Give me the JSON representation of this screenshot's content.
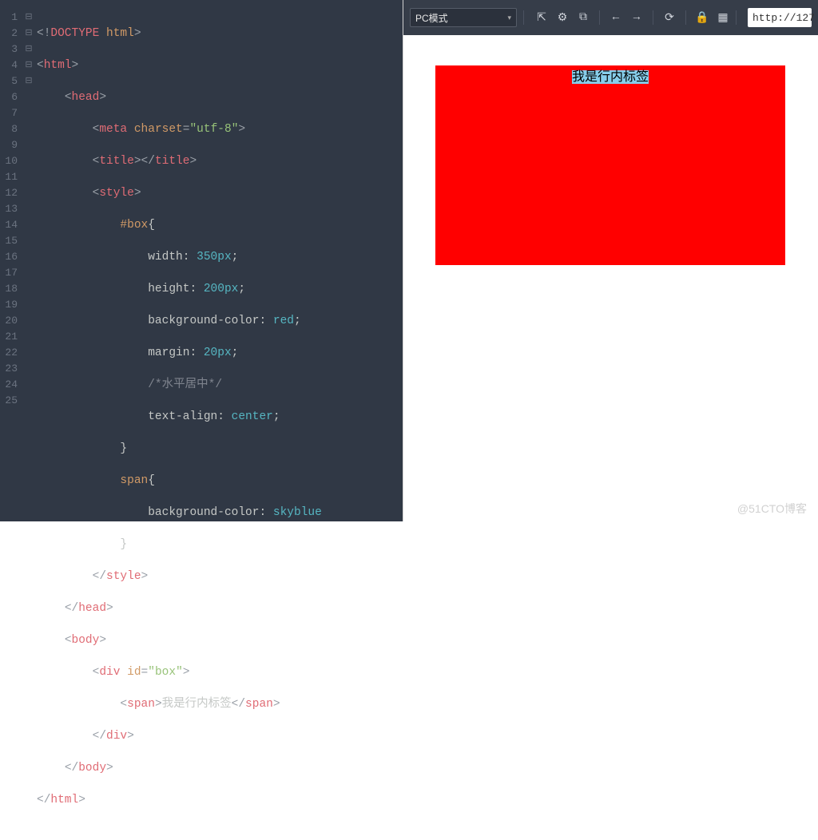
{
  "editor": {
    "line_numbers": [
      "1",
      "2",
      "3",
      "4",
      "5",
      "6",
      "7",
      "8",
      "9",
      "10",
      "11",
      "12",
      "13",
      "14",
      "15",
      "16",
      "17",
      "18",
      "19",
      "20",
      "21",
      "22",
      "23",
      "24",
      "25"
    ],
    "fold_markers": [
      "",
      "⊟",
      "⊟",
      "",
      "",
      "⊟",
      "",
      "",
      "",
      "",
      "",
      "",
      "",
      "",
      "",
      "",
      "",
      "",
      "",
      "⊟",
      "⊟",
      "",
      "",
      "",
      ""
    ]
  },
  "code": {
    "l1": {
      "a": "<!",
      "b": "DOCTYPE",
      "c": " ",
      "d": "html",
      "e": ">"
    },
    "l2": {
      "a": "<",
      "b": "html",
      "c": ">"
    },
    "l3": {
      "indent": "    ",
      "a": "<",
      "b": "head",
      "c": ">"
    },
    "l4": {
      "indent": "        ",
      "a": "<",
      "b": "meta",
      "c": " ",
      "attr": "charset",
      "eq": "=",
      "q1": "\"",
      "v": "utf-8",
      "q2": "\"",
      "d": ">"
    },
    "l5": {
      "indent": "        ",
      "a": "<",
      "b": "title",
      "c": ">",
      "d": "</",
      "e": "title",
      "f": ">"
    },
    "l6": {
      "indent": "        ",
      "a": "<",
      "b": "style",
      "c": ">"
    },
    "l7": {
      "indent": "            ",
      "sel": "#box",
      "brace": "{"
    },
    "l8": {
      "indent": "                ",
      "prop": "width",
      "colon": ": ",
      "val": "350px",
      "sc": ";"
    },
    "l9": {
      "indent": "                ",
      "prop": "height",
      "colon": ": ",
      "val": "200px",
      "sc": ";"
    },
    "l10": {
      "indent": "                ",
      "prop": "background-color",
      "colon": ": ",
      "val": "red",
      "sc": ";"
    },
    "l11": {
      "indent": "                ",
      "prop": "margin",
      "colon": ": ",
      "val": "20px",
      "sc": ";"
    },
    "l12": {
      "indent": "                ",
      "comment": "/*水平居中*/"
    },
    "l13": {
      "indent": "                ",
      "prop": "text-align",
      "colon": ": ",
      "val": "center",
      "sc": ";"
    },
    "l14": {
      "indent": "            ",
      "brace": "}"
    },
    "l15": {
      "indent": "            ",
      "sel": "span",
      "brace": "{"
    },
    "l16": {
      "indent": "                ",
      "prop": "background-color",
      "colon": ": ",
      "val": "skyblue"
    },
    "l17": {
      "indent": "            ",
      "brace": "}"
    },
    "l18": {
      "indent": "        ",
      "a": "</",
      "b": "style",
      "c": ">"
    },
    "l19": {
      "indent": "    ",
      "a": "</",
      "b": "head",
      "c": ">"
    },
    "l20": {
      "indent": "    ",
      "a": "<",
      "b": "body",
      "c": ">"
    },
    "l21": {
      "indent": "        ",
      "a": "<",
      "b": "div",
      "c": " ",
      "attr": "id",
      "eq": "=",
      "q1": "\"",
      "v": "box",
      "q2": "\"",
      "d": ">"
    },
    "l22": {
      "indent": "            ",
      "a": "<",
      "b": "span",
      "c": ">",
      "text": "我是行内标签",
      "d": "</",
      "e": "span",
      "f": ">"
    },
    "l23": {
      "indent": "        ",
      "a": "</",
      "b": "div",
      "c": ">"
    },
    "l24": {
      "indent": "    ",
      "a": "</",
      "b": "body",
      "c": ">"
    },
    "l25": {
      "a": "</",
      "b": "html",
      "c": ">"
    }
  },
  "browser": {
    "mode_label": "PC模式",
    "url": "http://127",
    "rendered_span_text": "我是行内标签"
  },
  "icons": {
    "popout": "⇱",
    "gear": "⚙",
    "screenshot": "⧉",
    "back": "←",
    "forward": "→",
    "reload": "⟳",
    "lock": "🔒",
    "qr": "▦"
  },
  "watermark": "@51CTO博客"
}
